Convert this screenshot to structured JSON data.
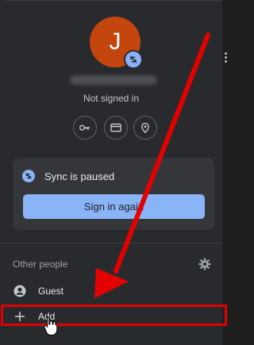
{
  "profile": {
    "avatar_letter": "J",
    "status": "Not signed in",
    "avatar_color": "#c4450e"
  },
  "quick_actions": {
    "icons": [
      "key-icon",
      "credit-card-icon",
      "location-pin-icon"
    ]
  },
  "sync": {
    "message": "Sync is paused",
    "button_label": "Sign in again"
  },
  "other_people": {
    "title": "Other people",
    "guest_label": "Guest",
    "add_label": "Add"
  },
  "colors": {
    "accent": "#8ab4f8",
    "annotation": "#e50000"
  }
}
